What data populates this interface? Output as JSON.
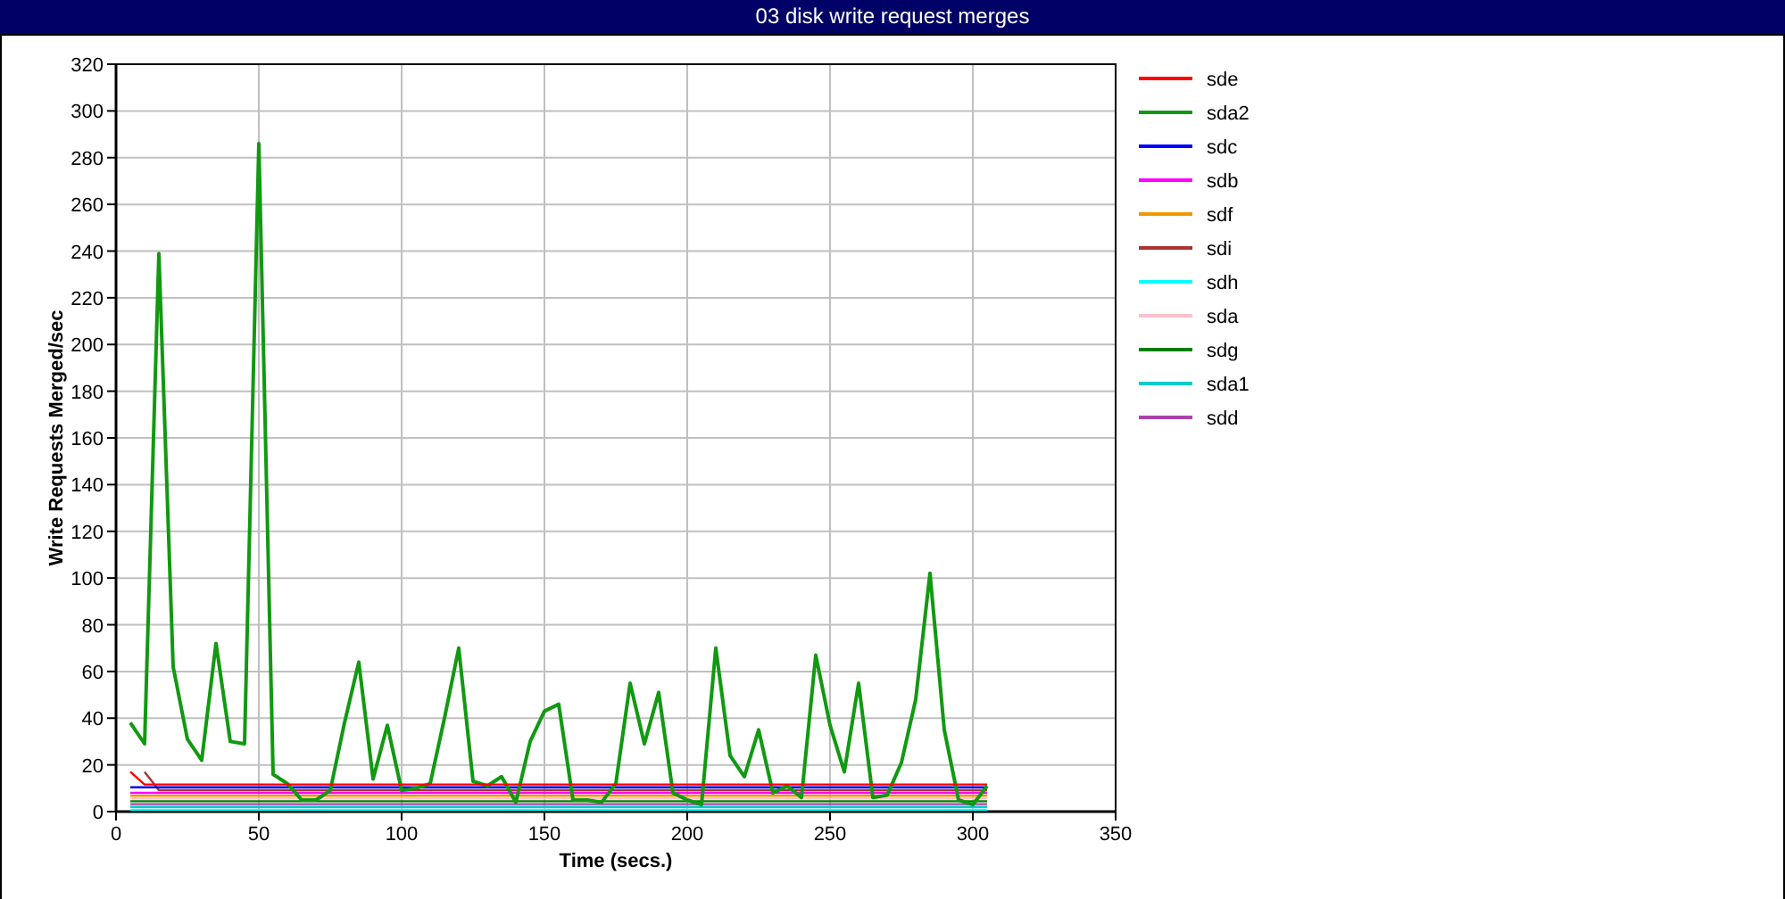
{
  "window": {
    "title": "03 disk write request merges"
  },
  "chart": {
    "chart_data": {
      "type": "line",
      "xlabel": "Time (secs.)",
      "ylabel": "Write Requests Merged/sec",
      "grid": true,
      "legend": "right",
      "x": [
        5,
        10,
        15,
        20,
        25,
        30,
        35,
        40,
        45,
        50,
        55,
        60,
        65,
        70,
        75,
        80,
        85,
        90,
        95,
        100,
        105,
        110,
        115,
        120,
        125,
        130,
        135,
        140,
        145,
        150,
        155,
        160,
        165,
        170,
        175,
        180,
        185,
        190,
        195,
        200,
        205,
        210,
        215,
        220,
        225,
        230,
        235,
        240,
        245,
        250,
        255,
        260,
        265,
        270,
        275,
        280,
        285,
        290,
        295,
        300,
        305
      ],
      "xlim": [
        0,
        350
      ],
      "ylim": [
        0,
        320
      ],
      "xticks": [
        0,
        50,
        100,
        150,
        200,
        250,
        300,
        350
      ],
      "yticks": [
        0,
        20,
        40,
        60,
        80,
        100,
        120,
        140,
        160,
        180,
        200,
        220,
        240,
        260,
        280,
        300,
        320
      ],
      "series": [
        {
          "name": "sde",
          "color": "#ff0000",
          "values": [
            17,
            11.6,
            11.6,
            11.6,
            11.6,
            11.6,
            11.6,
            11.6,
            11.6,
            11.6,
            11.6,
            11.6,
            11.6,
            11.6,
            11.6,
            11.6,
            11.6,
            11.6,
            11.6,
            11.6,
            11.6,
            11.6,
            11.6,
            11.6,
            11.6,
            11.6,
            11.6,
            11.6,
            11.6,
            11.6,
            11.6,
            11.6,
            11.6,
            11.6,
            11.6,
            11.6,
            11.6,
            11.6,
            11.6,
            11.6,
            11.6,
            11.6,
            11.6,
            11.6,
            11.6,
            11.6,
            11.6,
            11.6,
            11.6,
            11.6,
            11.6,
            11.6,
            11.6,
            11.6,
            11.6,
            11.6,
            11.6,
            11.6,
            11.6,
            11.6,
            11.6
          ]
        },
        {
          "name": "sda2",
          "color": "#119911",
          "values": [
            38,
            29,
            239,
            62,
            31,
            22,
            72,
            30,
            29,
            286,
            16,
            12,
            5,
            5,
            9,
            38,
            64,
            14,
            37,
            9,
            10,
            12,
            40,
            70,
            13,
            11,
            15,
            4,
            30,
            43,
            46,
            5,
            5,
            4,
            12,
            55,
            29,
            51,
            8,
            5,
            3,
            70,
            24,
            15,
            35,
            8,
            11,
            6,
            67,
            37,
            17,
            55,
            6,
            7,
            21,
            48,
            102,
            35,
            5,
            3,
            11
          ]
        },
        {
          "name": "sdc",
          "color": "#0000ff",
          "values": [
            10.4,
            10.4,
            10.4,
            10.4,
            10.4,
            10.4,
            10.4,
            10.4,
            10.4,
            10.4,
            10.4,
            10.4,
            10.4,
            10.4,
            10.4,
            10.4,
            10.4,
            10.4,
            10.4,
            10.4,
            10.4,
            10.4,
            10.4,
            10.4,
            10.4,
            10.4,
            10.4,
            10.4,
            10.4,
            10.4,
            10.4,
            10.4,
            10.4,
            10.4,
            10.4,
            10.4,
            10.4,
            10.4,
            10.4,
            10.4,
            10.4,
            10.4,
            10.4,
            10.4,
            10.4,
            10.4,
            10.4,
            10.4,
            10.4,
            10.4,
            10.4,
            10.4,
            10.4,
            10.4,
            10.4,
            10.4,
            10.4,
            10.4,
            10.4,
            10.4,
            10.4
          ]
        },
        {
          "name": "sdb",
          "color": "#ff00ff",
          "values": [
            8,
            8,
            8,
            8,
            8,
            8,
            8,
            8,
            8,
            8,
            8,
            8,
            8,
            8,
            8,
            8,
            8,
            8,
            8,
            8,
            8,
            8,
            8,
            8,
            8,
            8,
            8,
            8,
            8,
            8,
            8,
            8,
            8,
            8,
            8,
            8,
            8,
            8,
            8,
            8,
            8,
            8,
            8,
            8,
            8,
            8,
            8,
            8,
            8,
            8,
            8,
            8,
            8,
            8,
            8,
            8,
            8,
            8,
            8,
            8,
            8
          ]
        },
        {
          "name": "sdf",
          "color": "#ee9900",
          "values": [
            6.8,
            6.8,
            6.8,
            6.8,
            6.8,
            6.8,
            6.8,
            6.8,
            6.8,
            6.8,
            6.8,
            6.8,
            6.8,
            6.8,
            6.8,
            6.8,
            6.8,
            6.8,
            6.8,
            6.8,
            6.8,
            6.8,
            6.8,
            6.8,
            6.8,
            6.8,
            6.8,
            6.8,
            6.8,
            6.8,
            6.8,
            6.8,
            6.8,
            6.8,
            6.8,
            6.8,
            6.8,
            6.8,
            6.8,
            6.8,
            6.8,
            6.8,
            6.8,
            6.8,
            6.8,
            6.8,
            6.8,
            6.8,
            6.8,
            6.8,
            6.8,
            6.8,
            6.8,
            6.8,
            6.8,
            6.8,
            6.8,
            6.8,
            6.8,
            6.8,
            6.8
          ]
        },
        {
          "name": "sdi",
          "color": "#aa3333",
          "values": [
            null,
            17,
            9.2,
            9.2,
            9.2,
            9.2,
            9.2,
            9.2,
            9.2,
            9.2,
            9.2,
            9.2,
            9.2,
            9.2,
            9.2,
            9.2,
            9.2,
            9.2,
            9.2,
            9.2,
            9.2,
            9.2,
            9.2,
            9.2,
            9.2,
            9.2,
            9.2,
            9.2,
            9.2,
            9.2,
            9.2,
            9.2,
            9.2,
            9.2,
            9.2,
            9.2,
            9.2,
            9.2,
            9.2,
            9.2,
            9.2,
            9.2,
            9.2,
            9.2,
            9.2,
            9.2,
            9.2,
            9.2,
            9.2,
            9.2,
            9.2,
            9.2,
            9.2,
            9.2,
            9.2,
            9.2,
            9.2,
            9.2,
            9.2,
            9.2,
            9.2
          ]
        },
        {
          "name": "sdh",
          "color": "#00ffff",
          "values": [
            0.8,
            0.8,
            0.8,
            0.8,
            0.8,
            0.8,
            0.8,
            0.8,
            0.8,
            0.8,
            0.8,
            0.8,
            0.8,
            0.8,
            0.8,
            0.8,
            0.8,
            0.8,
            0.8,
            0.8,
            0.8,
            0.8,
            0.8,
            0.8,
            0.8,
            0.8,
            0.8,
            0.8,
            0.8,
            0.8,
            0.8,
            0.8,
            0.8,
            0.8,
            0.8,
            0.8,
            0.8,
            0.8,
            0.8,
            0.8,
            0.8,
            0.8,
            0.8,
            0.8,
            0.8,
            0.8,
            0.8,
            0.8,
            0.8,
            0.8,
            0.8,
            0.8,
            0.8,
            0.8,
            0.8,
            0.8,
            0.8,
            0.8,
            0.8,
            0.8,
            0.8
          ]
        },
        {
          "name": "sda",
          "color": "#ffc0cb",
          "values": [
            5.6,
            5.6,
            5.6,
            5.6,
            5.6,
            5.6,
            5.6,
            5.6,
            5.6,
            5.6,
            5.6,
            5.6,
            5.6,
            5.6,
            5.6,
            5.6,
            5.6,
            5.6,
            5.6,
            5.6,
            5.6,
            5.6,
            5.6,
            5.6,
            5.6,
            5.6,
            5.6,
            5.6,
            5.6,
            5.6,
            5.6,
            5.6,
            5.6,
            5.6,
            5.6,
            5.6,
            5.6,
            5.6,
            5.6,
            5.6,
            5.6,
            5.6,
            5.6,
            5.6,
            5.6,
            5.6,
            5.6,
            5.6,
            5.6,
            5.6,
            5.6,
            5.6,
            5.6,
            5.6,
            5.6,
            5.6,
            5.6,
            5.6,
            5.6,
            5.6,
            5.6
          ]
        },
        {
          "name": "sdg",
          "color": "#007f00",
          "values": [
            4.4,
            4.4,
            4.4,
            4.4,
            4.4,
            4.4,
            4.4,
            4.4,
            4.4,
            4.4,
            4.4,
            4.4,
            4.4,
            4.4,
            4.4,
            4.4,
            4.4,
            4.4,
            4.4,
            4.4,
            4.4,
            4.4,
            4.4,
            4.4,
            4.4,
            4.4,
            4.4,
            4.4,
            4.4,
            4.4,
            4.4,
            4.4,
            4.4,
            4.4,
            4.4,
            4.4,
            4.4,
            4.4,
            4.4,
            4.4,
            4.4,
            4.4,
            4.4,
            4.4,
            4.4,
            4.4,
            4.4,
            4.4,
            4.4,
            4.4,
            4.4,
            4.4,
            4.4,
            4.4,
            4.4,
            4.4,
            4.4,
            4.4,
            4.4,
            4.4,
            4.4
          ]
        },
        {
          "name": "sda1",
          "color": "#00cccc",
          "values": [
            2,
            2,
            2,
            2,
            2,
            2,
            2,
            2,
            2,
            2,
            2,
            2,
            2,
            2,
            2,
            2,
            2,
            2,
            2,
            2,
            2,
            2,
            2,
            2,
            2,
            2,
            2,
            2,
            2,
            2,
            2,
            2,
            2,
            2,
            2,
            2,
            2,
            2,
            2,
            2,
            2,
            2,
            2,
            2,
            2,
            2,
            2,
            2,
            2,
            2,
            2,
            2,
            2,
            2,
            2,
            2,
            2,
            2,
            2,
            2,
            2
          ]
        },
        {
          "name": "sdd",
          "color": "#aa44aa",
          "values": [
            3.2,
            3.2,
            3.2,
            3.2,
            3.2,
            3.2,
            3.2,
            3.2,
            3.2,
            3.2,
            3.2,
            3.2,
            3.2,
            3.2,
            3.2,
            3.2,
            3.2,
            3.2,
            3.2,
            3.2,
            3.2,
            3.2,
            3.2,
            3.2,
            3.2,
            3.2,
            3.2,
            3.2,
            3.2,
            3.2,
            3.2,
            3.2,
            3.2,
            3.2,
            3.2,
            3.2,
            3.2,
            3.2,
            3.2,
            3.2,
            3.2,
            3.2,
            3.2,
            3.2,
            3.2,
            3.2,
            3.2,
            3.2,
            3.2,
            3.2,
            3.2,
            3.2,
            3.2,
            3.2,
            3.2,
            3.2,
            3.2,
            3.2,
            3.2,
            3.2,
            3.2
          ]
        }
      ]
    }
  }
}
